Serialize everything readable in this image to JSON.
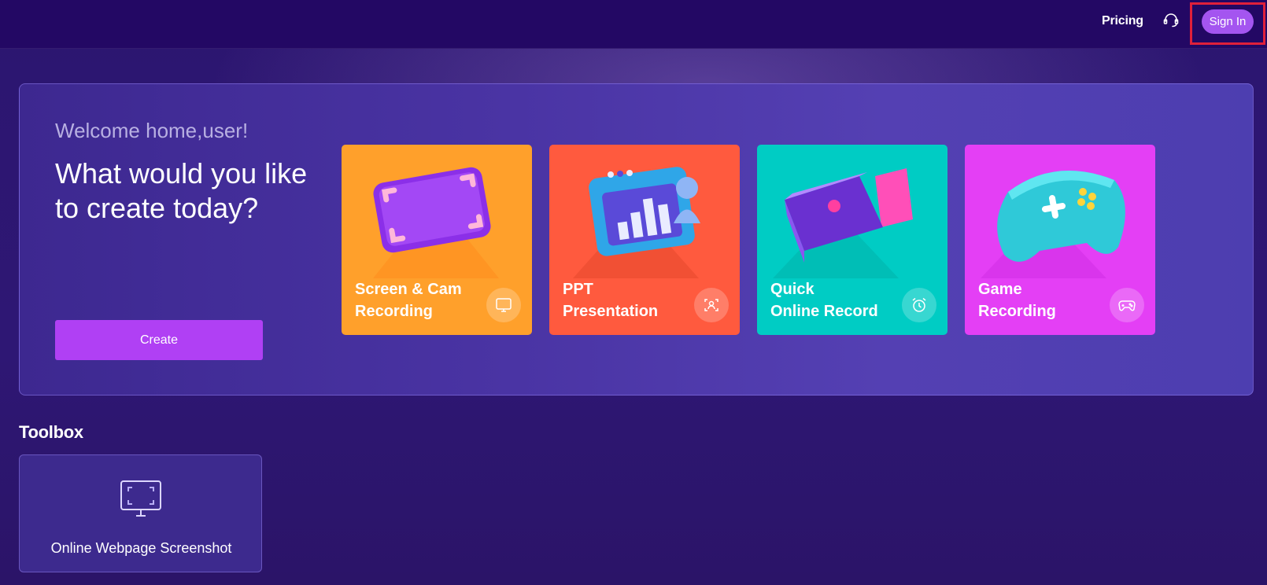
{
  "header": {
    "pricing_label": "Pricing",
    "signin_label": "Sign In"
  },
  "hero": {
    "welcome": "Welcome home,user!",
    "headline": "What would you like to create today?",
    "create_label": "Create",
    "cards": [
      {
        "line1": "Screen & Cam",
        "line2": "Recording",
        "color": "#ffa02b",
        "icon": "monitor-icon"
      },
      {
        "line1": "PPT",
        "line2": "Presentation",
        "color": "#ff5a3e",
        "icon": "presenter-icon"
      },
      {
        "line1": "Quick",
        "line2": "Online Record",
        "color": "#00ccc4",
        "icon": "alarm-clock-icon"
      },
      {
        "line1": "Game",
        "line2": "Recording",
        "color": "#e43ff5",
        "icon": "gamepad-icon"
      }
    ]
  },
  "toolbox": {
    "title": "Toolbox",
    "items": [
      {
        "label": "Online Webpage Screenshot",
        "icon": "screenshot-monitor-icon"
      }
    ]
  },
  "colors": {
    "nav_bg": "#230864",
    "signin_bg": "#a455f0",
    "create_bg": "#b040f4",
    "highlight": "#e0203a"
  }
}
